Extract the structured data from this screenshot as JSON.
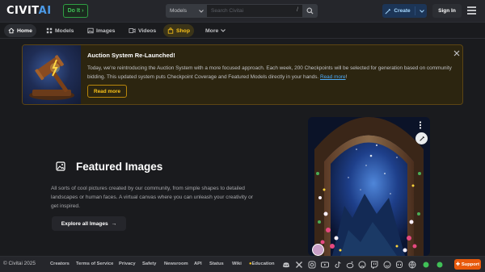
{
  "header": {
    "logo_main": "CIVIT",
    "logo_accent": "AI",
    "doit_label": "Do It",
    "search_scope": "Models",
    "search_placeholder": "Search Civitai",
    "search_shortcut": "/",
    "create_label": "Create",
    "signin_label": "Sign In"
  },
  "nav": {
    "items": [
      {
        "label": "Home",
        "icon": "home-icon"
      },
      {
        "label": "Models",
        "icon": "grid-icon"
      },
      {
        "label": "Images",
        "icon": "photo-icon"
      },
      {
        "label": "Videos",
        "icon": "video-icon"
      },
      {
        "label": "Shop",
        "icon": "shopping-bag-icon"
      },
      {
        "label": "More",
        "icon": "chevron-down-icon"
      }
    ],
    "active": "Home"
  },
  "banner": {
    "title": "Auction System Re-Launched!",
    "text": "Today, we're reintroducing the Auction System with a more focused approach. Each week, 200 Checkpoints will be selected for generation based on community bidding. This updated system puts Checkpoint Coverage and Featured Models directly in your hands.",
    "link_label": "Read more",
    "link_suffix": "!",
    "button_label": "Read more"
  },
  "featured": {
    "title": "Featured Images",
    "description": "All sorts of cool pictures created by our community, from simple shapes to detailed landscapes or human faces. A virtual canvas where you can unleash your creativity or get inspired.",
    "button_label": "Explore all Images",
    "button_arrow": "→"
  },
  "footer": {
    "copyright": "© Civitai 2025",
    "links": [
      "Creators",
      "Terms of Service",
      "Privacy",
      "Safety",
      "Newsroom",
      "API",
      "Status",
      "Wiki"
    ],
    "education_label": "Education",
    "support_label": "Support"
  },
  "colors": {
    "background": "#1a1b1e",
    "header": "#25262b",
    "accent_blue": "#4c9be8",
    "green": "#40c057",
    "gold": "#fcc419",
    "support": "#e8590c"
  }
}
